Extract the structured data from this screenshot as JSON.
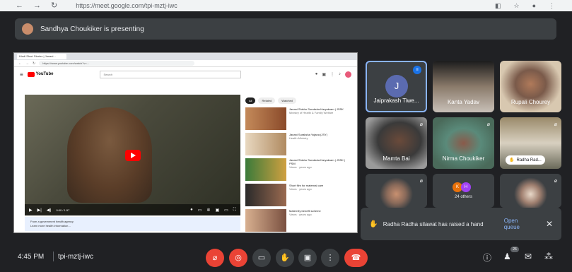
{
  "browser": {
    "url": "https://meet.google.com/tpi-mztj-iwc",
    "nav_back": "←",
    "nav_forward": "→",
    "nav_reload": "↻"
  },
  "banner": {
    "text": "Sandhya Choukiker is presenting"
  },
  "shared_screen": {
    "tab_title": "Hindi Short Stories | Janani...",
    "address": "https://www.youtube.com/watch?v=...",
    "yt_logo": "YouTube",
    "yt_search_placeholder": "Search",
    "chips": [
      "All",
      "Related",
      "Watched"
    ],
    "video_time": "0:00 / 1:57",
    "info_line1": "From a government health agency",
    "info_line2": "Learn more health information…",
    "recommendations": [
      {
        "title": "Janani Shishu Suraksha Karyakram | JSSK",
        "sub": "Ministry of Health & Family Welfare"
      },
      {
        "title": "Janani Suraksha Yojana (JSY)",
        "sub": "Health Ministry"
      },
      {
        "title": "Janani Shishu Suraksha Karyakram | JSSK | PSM",
        "sub": "Views · years ago"
      },
      {
        "title": "Short film for maternal care",
        "sub": "Views · years ago"
      },
      {
        "title": "Maternity benefit scheme",
        "sub": "Views · years ago"
      }
    ]
  },
  "participants": [
    {
      "name": "Jaiprakash Tiwe...",
      "initial": "J",
      "active": true
    },
    {
      "name": "Kanta Yadav"
    },
    {
      "name": "Rupali Chourey"
    },
    {
      "name": "Mamta Bai"
    },
    {
      "name": "Nirma Choukiker"
    },
    {
      "name": "Radha Rad..."
    },
    {
      "name": ""
    },
    {
      "initials": [
        "K",
        "H"
      ],
      "others": "24 others"
    },
    {
      "name": ""
    }
  ],
  "toast": {
    "message": "Radha Radha silawat has raised a hand",
    "action": "Open queue",
    "close": "✕"
  },
  "bottom": {
    "time": "4:45 PM",
    "meeting_code": "tpi-mztj-iwc",
    "participant_count": "26"
  },
  "colors": {
    "accent": "#8ab4f8",
    "danger": "#ea4335",
    "surface": "#3c4043",
    "background": "#202124"
  }
}
